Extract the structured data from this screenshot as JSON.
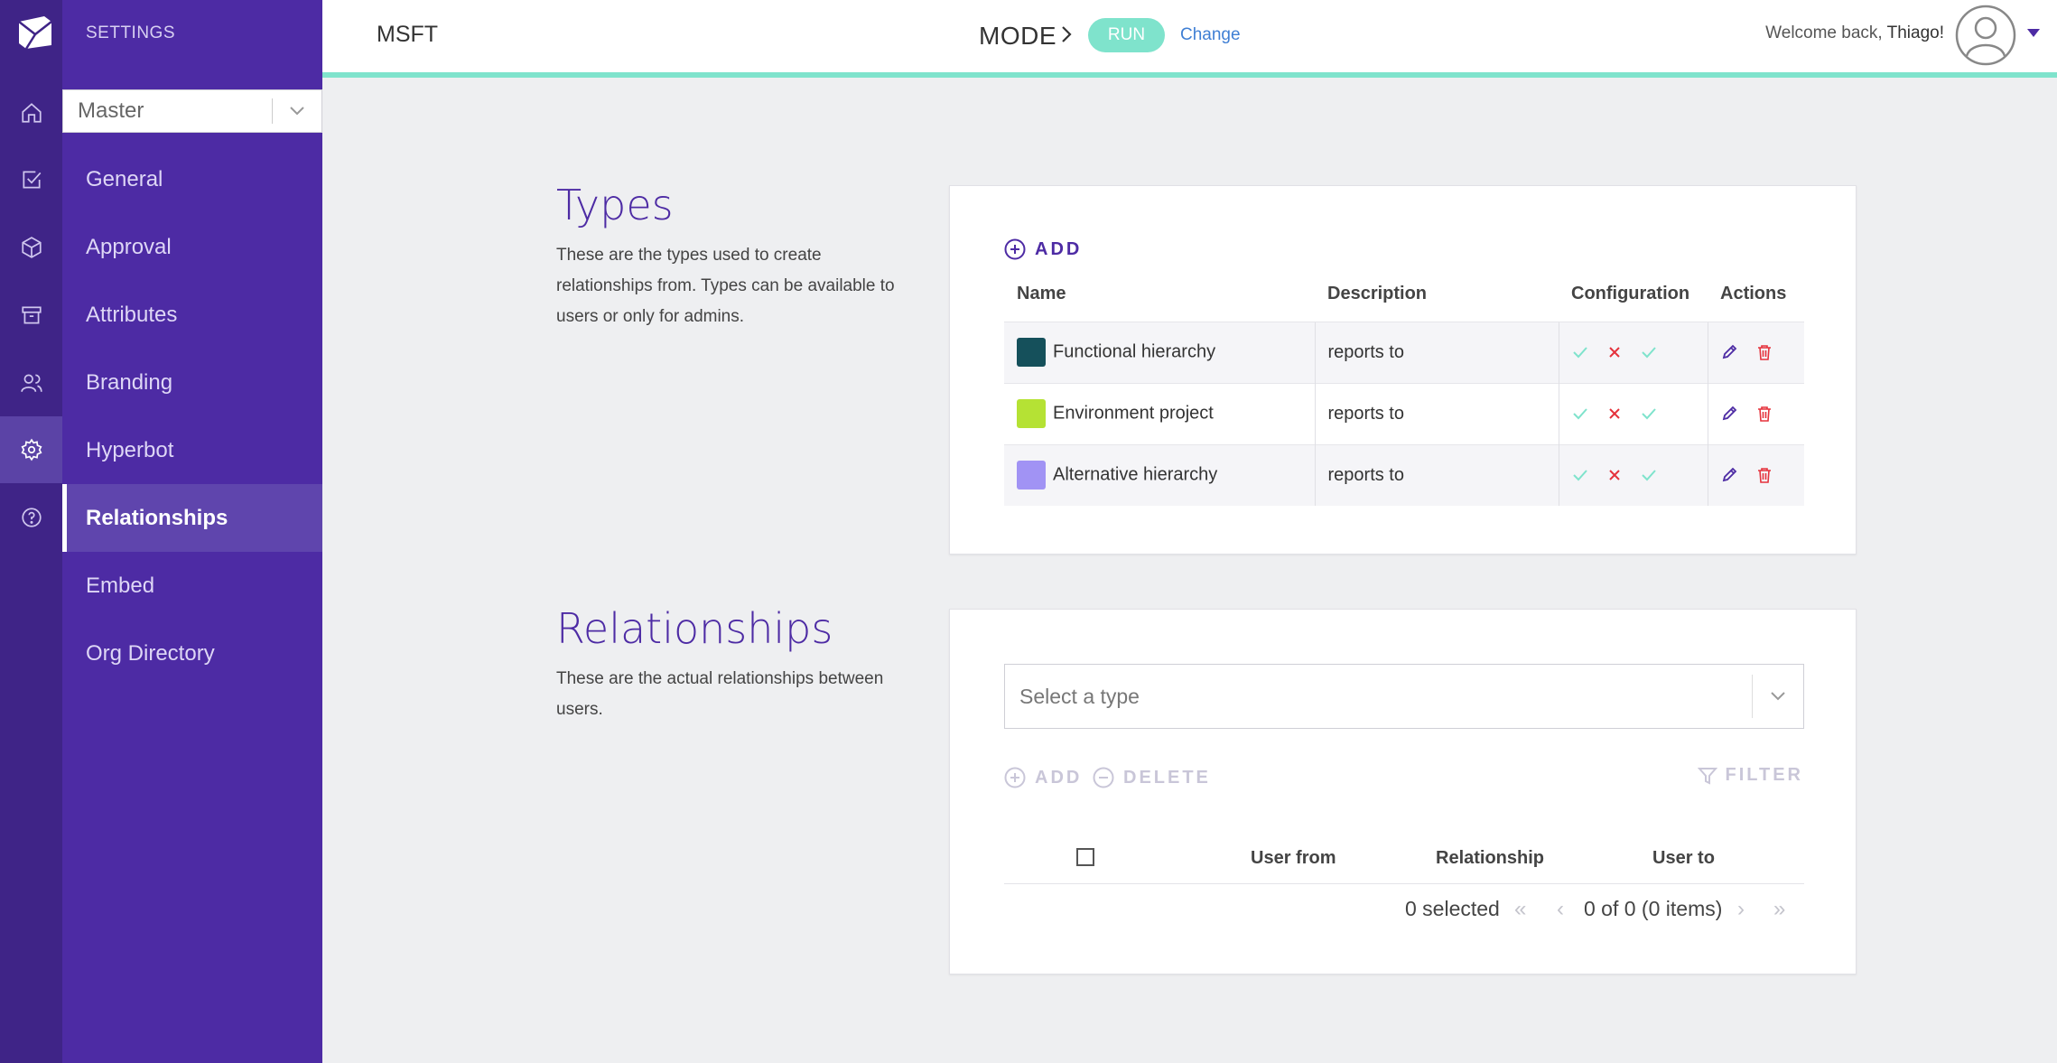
{
  "sidebar": {
    "heading": "SETTINGS",
    "master_select": "Master",
    "items": [
      {
        "label": "General"
      },
      {
        "label": "Approval"
      },
      {
        "label": "Attributes"
      },
      {
        "label": "Branding"
      },
      {
        "label": "Hyperbot"
      },
      {
        "label": "Relationships",
        "active": true
      },
      {
        "label": "Embed"
      },
      {
        "label": "Org Directory"
      }
    ]
  },
  "rail": {
    "icons": [
      "home-icon",
      "check-square-icon",
      "box-icon",
      "archive-icon",
      "users-icon",
      "gear-icon",
      "help-icon"
    ],
    "active": "gear-icon"
  },
  "header": {
    "org": "MSFT",
    "mode_label": "MODE",
    "mode_value": "RUN",
    "change_link": "Change",
    "welcome": "Welcome back,",
    "user_name": "Thiago!"
  },
  "types": {
    "title": "Types",
    "description": "These are the types used to create relationships from. Types can be available to users or only for admins.",
    "add_label": "ADD",
    "columns": [
      "Name",
      "Description",
      "Configuration",
      "Actions"
    ],
    "rows": [
      {
        "name": "Functional hierarchy",
        "color": "#15505b",
        "description": "reports to"
      },
      {
        "name": "Environment project",
        "color": "#b5e234",
        "description": "reports to"
      },
      {
        "name": "Alternative hierarchy",
        "color": "#a193f4",
        "description": "reports to"
      }
    ]
  },
  "relationships": {
    "title": "Relationships",
    "description": "These are the actual relationships between users.",
    "select_placeholder": "Select a type",
    "add_label": "ADD",
    "delete_label": "DELETE",
    "filter_label": "FILTER",
    "columns": [
      "User from",
      "Relationship",
      "User to"
    ],
    "selected_text": "0 selected",
    "page_text": "0 of 0 (0 items)"
  },
  "colors": {
    "brand": "#4d2ba4",
    "rail": "#3f2487",
    "accent": "#7fe3cc",
    "link": "#3f7fd4",
    "danger": "#e5323c"
  }
}
